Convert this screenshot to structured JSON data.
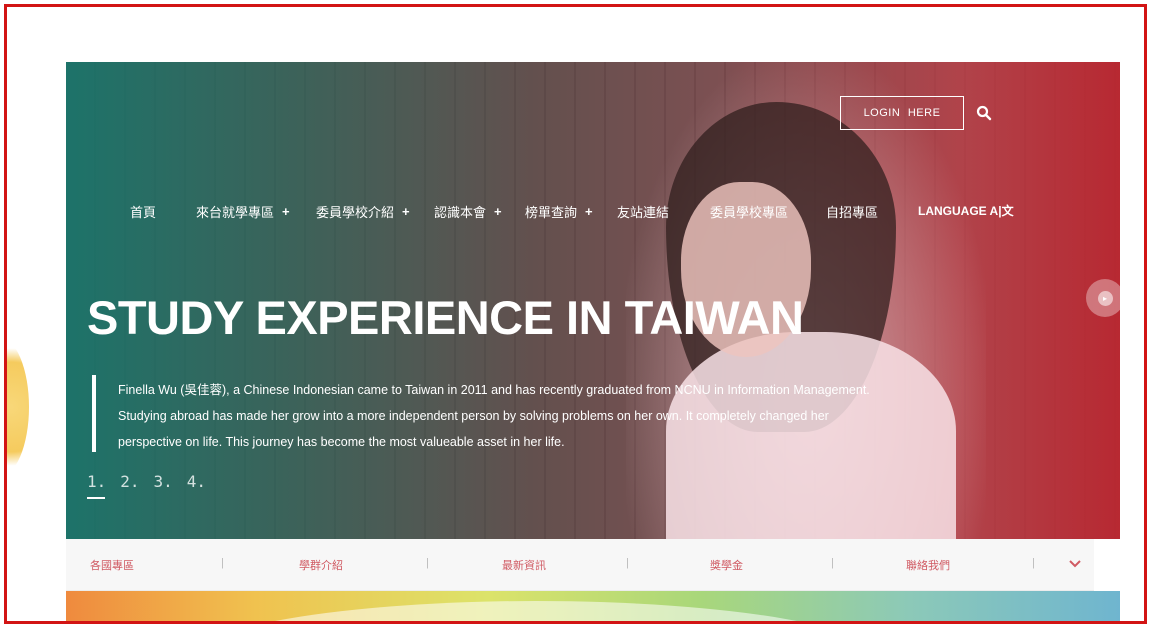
{
  "header": {
    "login_label": "LOGIN HERE",
    "search_icon": "search-icon"
  },
  "nav": {
    "items": [
      {
        "label": "首頁",
        "has_submenu": false
      },
      {
        "label": "來台就學專區",
        "has_submenu": true
      },
      {
        "label": "委員學校介紹",
        "has_submenu": true
      },
      {
        "label": "認識本會",
        "has_submenu": true
      },
      {
        "label": "榜單查詢",
        "has_submenu": true
      },
      {
        "label": "友站連結",
        "has_submenu": false
      },
      {
        "label": "委員學校專區",
        "has_submenu": false
      },
      {
        "label": "自招專區",
        "has_submenu": false
      },
      {
        "label": "LANGUAGE A|文",
        "has_submenu": false
      }
    ],
    "plus_symbol": "+"
  },
  "hero": {
    "title": "STUDY EXPERIENCE IN TAIWAN",
    "text": "Finella Wu (吳佳蓉), a Chinese Indonesian came to Taiwan in 2011 and has recently graduated from NCNU in Information Management. Studying abroad has made her grow into a more independent person by solving problems on her own. It completely changed her perspective on life. This journey has become the most valueable asset in her life.",
    "slides": [
      "1.",
      "2.",
      "3.",
      "4."
    ],
    "active_slide": 0,
    "next_icon": "chevron-right-icon"
  },
  "subnav": {
    "items": [
      "各國專區",
      "學群介紹",
      "最新資訊",
      "獎學金",
      "聯絡我們"
    ],
    "separator": "|",
    "expand_icon": "chevron-down-icon"
  },
  "colors": {
    "frame_border": "#d21414",
    "subnav_text": "#d05a63",
    "hero_left_tint": "#1a786e",
    "hero_right_tint": "#be2832"
  }
}
